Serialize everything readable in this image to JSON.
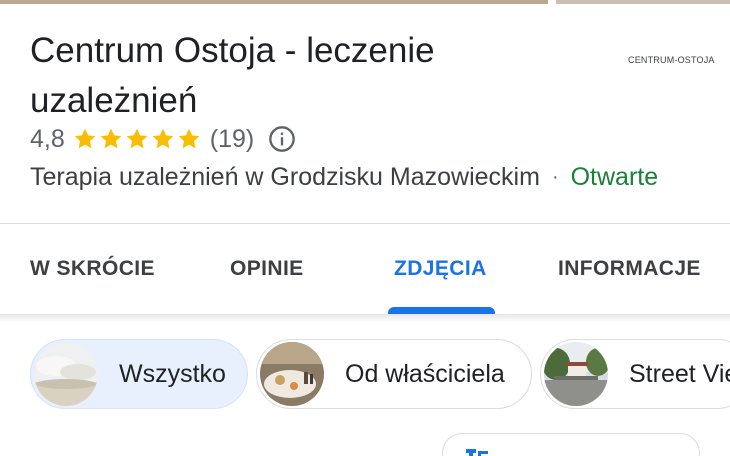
{
  "place": {
    "title": "Centrum Ostoja - leczenie uzależnień",
    "logo_text": "CENTRUM-OSTOJA",
    "rating": "4,8",
    "stars_value": 4.8,
    "stars_max": 5,
    "review_count": "(19)",
    "category": "Terapia uzależnień w Grodzisku Mazowieckim",
    "separator": "·",
    "status": "Otwarte"
  },
  "tabs": [
    {
      "label": "W SKRÓCIE",
      "active": false
    },
    {
      "label": "OPINIE",
      "active": false
    },
    {
      "label": "ZDJĘCIA",
      "active": true
    },
    {
      "label": "INFORMACJE",
      "active": false
    }
  ],
  "photo_filters": [
    {
      "label": "Wszystko",
      "selected": true
    },
    {
      "label": "Od właściciela",
      "selected": false
    },
    {
      "label": "Street View",
      "selected": false
    }
  ],
  "colors": {
    "accent": "#1a73e8",
    "star": "#fbbc04",
    "open": "#188038",
    "chip_selected_bg": "#e8f0fe"
  },
  "icons": {
    "info": "info-circle-icon",
    "star": "star-icon"
  }
}
